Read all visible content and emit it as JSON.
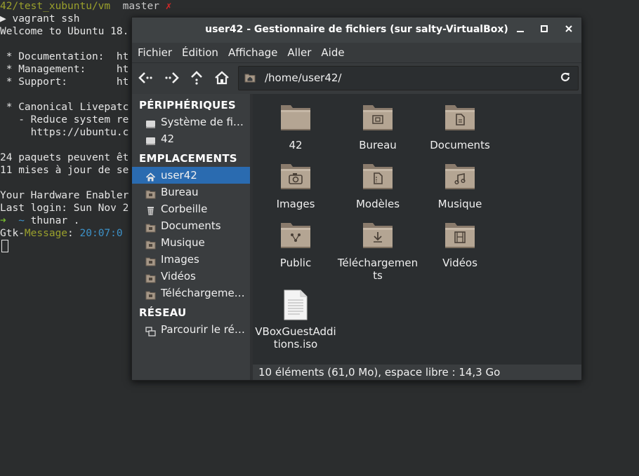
{
  "terminal": {
    "lines": [
      {
        "segments": [
          {
            "text": "42/test_xubuntu/vm",
            "cls": "t-ylw"
          },
          {
            "text": "  master ",
            "cls": "t-gry"
          },
          {
            "text": "✗",
            "cls": "t-red"
          }
        ]
      },
      {
        "segments": [
          {
            "text": "▶ vagrant ssh",
            "cls": ""
          }
        ]
      },
      {
        "segments": [
          {
            "text": "Welcome to Ubuntu 18.",
            "cls": ""
          }
        ]
      },
      {
        "segments": [
          {
            "text": "",
            "cls": ""
          }
        ]
      },
      {
        "segments": [
          {
            "text": " * Documentation:  ht",
            "cls": ""
          }
        ]
      },
      {
        "segments": [
          {
            "text": " * Management:     ht",
            "cls": ""
          }
        ]
      },
      {
        "segments": [
          {
            "text": " * Support:        ht",
            "cls": ""
          }
        ]
      },
      {
        "segments": [
          {
            "text": "",
            "cls": ""
          }
        ]
      },
      {
        "segments": [
          {
            "text": " * Canonical Livepatc",
            "cls": ""
          }
        ]
      },
      {
        "segments": [
          {
            "text": "   - Reduce system re",
            "cls": ""
          }
        ]
      },
      {
        "segments": [
          {
            "text": "     https://ubuntu.c",
            "cls": ""
          }
        ]
      },
      {
        "segments": [
          {
            "text": "",
            "cls": ""
          }
        ]
      },
      {
        "segments": [
          {
            "text": "24 paquets peuvent êt",
            "cls": ""
          }
        ]
      },
      {
        "segments": [
          {
            "text": "11 mises à jour de se",
            "cls": ""
          }
        ]
      },
      {
        "segments": [
          {
            "text": "",
            "cls": ""
          }
        ]
      },
      {
        "segments": [
          {
            "text": "Your Hardware Enabler",
            "cls": ""
          }
        ]
      },
      {
        "segments": [
          {
            "text": "Last login: Sun Nov 2",
            "cls": ""
          }
        ]
      },
      {
        "segments": [
          {
            "text": "➜ ",
            "cls": "t-grn"
          },
          {
            "text": " ~ ",
            "cls": "t-blu"
          },
          {
            "text": "thunar .",
            "cls": ""
          }
        ]
      },
      {
        "segments": [
          {
            "text": "Gtk-",
            "cls": ""
          },
          {
            "text": "Message",
            "cls": "t-ylw"
          },
          {
            "text": ": ",
            "cls": ""
          },
          {
            "text": "20:07:0",
            "cls": "t-blu"
          }
        ]
      }
    ]
  },
  "window": {
    "title": "user42 - Gestionnaire de fichiers (sur salty-VirtualBox)",
    "minimize_glyph": "—",
    "maximize_glyph": "□",
    "close_glyph": "✕"
  },
  "menubar": {
    "items": [
      "Fichier",
      "Édition",
      "Affichage",
      "Aller",
      "Aide"
    ]
  },
  "toolbar": {
    "path": "/home/user42/",
    "reload_glyph": "⟳"
  },
  "sidebar": {
    "sections": [
      {
        "title": "PÉRIPHÉRIQUES",
        "items": [
          {
            "label": "Système de fi…",
            "icon": "drive-icon"
          },
          {
            "label": "42",
            "icon": "drive-icon"
          }
        ]
      },
      {
        "title": "EMPLACEMENTS",
        "items": [
          {
            "label": "user42",
            "icon": "home-icon",
            "selected": true
          },
          {
            "label": "Bureau",
            "icon": "folder-icon"
          },
          {
            "label": "Corbeille",
            "icon": "trash-icon"
          },
          {
            "label": "Documents",
            "icon": "folder-icon"
          },
          {
            "label": "Musique",
            "icon": "folder-icon"
          },
          {
            "label": "Images",
            "icon": "folder-icon"
          },
          {
            "label": "Vidéos",
            "icon": "folder-icon"
          },
          {
            "label": "Téléchargeme…",
            "icon": "folder-icon"
          }
        ]
      },
      {
        "title": "RÉSEAU",
        "items": [
          {
            "label": "Parcourir le ré…",
            "icon": "network-icon"
          }
        ]
      }
    ]
  },
  "files": [
    {
      "label": "42",
      "emblem": "none",
      "type": "folder"
    },
    {
      "label": "Bureau",
      "emblem": "desktop",
      "type": "folder"
    },
    {
      "label": "Documents",
      "emblem": "document",
      "type": "folder"
    },
    {
      "label": "Images",
      "emblem": "camera",
      "type": "folder"
    },
    {
      "label": "Modèles",
      "emblem": "template",
      "type": "folder"
    },
    {
      "label": "Musique",
      "emblem": "music",
      "type": "folder"
    },
    {
      "label": "Public",
      "emblem": "share",
      "type": "folder"
    },
    {
      "label": "Téléchargements",
      "emblem": "download",
      "type": "folder"
    },
    {
      "label": "Vidéos",
      "emblem": "film",
      "type": "folder"
    },
    {
      "label": "VBoxGuestAdditions.iso",
      "emblem": "none",
      "type": "file"
    }
  ],
  "status": {
    "text": "10 éléments (61,0 Mo), espace libre : 14,3 Go"
  }
}
